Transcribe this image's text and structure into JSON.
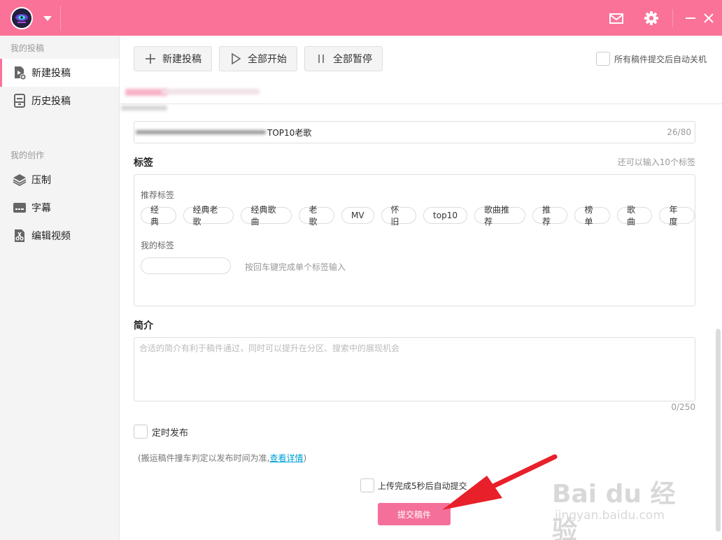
{
  "titlebar": {
    "icons": [
      "user-avatar",
      "chevron-down-icon",
      "mail-icon",
      "gear-icon",
      "minimize-icon",
      "close-icon"
    ],
    "accent": "#fb7299"
  },
  "sidebar": {
    "groups": [
      {
        "label": "我的投稿",
        "items": [
          {
            "label": "新建投稿",
            "icon": "new-upload-icon",
            "active": true
          },
          {
            "label": "历史投稿",
            "icon": "history-icon"
          }
        ]
      },
      {
        "label": "我的创作",
        "items": [
          {
            "label": "压制",
            "icon": "layers-icon"
          },
          {
            "label": "字幕",
            "icon": "subtitle-icon"
          },
          {
            "label": "编辑视频",
            "icon": "edit-video-icon"
          }
        ]
      }
    ]
  },
  "toolbar": {
    "new_upload": "新建投稿",
    "start_all": "全部开始",
    "pause_all": "全部暂停",
    "auto_shutdown": "所有稿件提交后自动关机"
  },
  "form": {
    "title_value": "TOP10老歌",
    "title_count": "26/80",
    "tags_label": "标签",
    "tags_remaining": "还可以输入10个标签",
    "recommended_label": "推荐标签",
    "recommended_tags": [
      "经典",
      "经典老歌",
      "经典歌曲",
      "老歌",
      "MV",
      "怀旧",
      "top10",
      "歌曲推荐",
      "推荐",
      "榜单",
      "歌曲",
      "年度"
    ],
    "my_tags_label": "我的标签",
    "my_tags_hint": "按回车键完成单个标签输入",
    "desc_label": "简介",
    "desc_placeholder": "合适的简介有利于稿件通过，同时可以提升在分区、搜索中的展现机会",
    "desc_count": "0/250",
    "schedule_label": "定时发布",
    "notice_prefix": "(搬运稿件撞车判定以发布时间为准,",
    "notice_link": "查看详情",
    "notice_suffix": ")",
    "auto_submit": "上传完成5秒后自动提交",
    "submit": "提交稿件"
  },
  "watermark": {
    "brand": "Bai du 经验",
    "url": "jingyan.baidu.com"
  }
}
